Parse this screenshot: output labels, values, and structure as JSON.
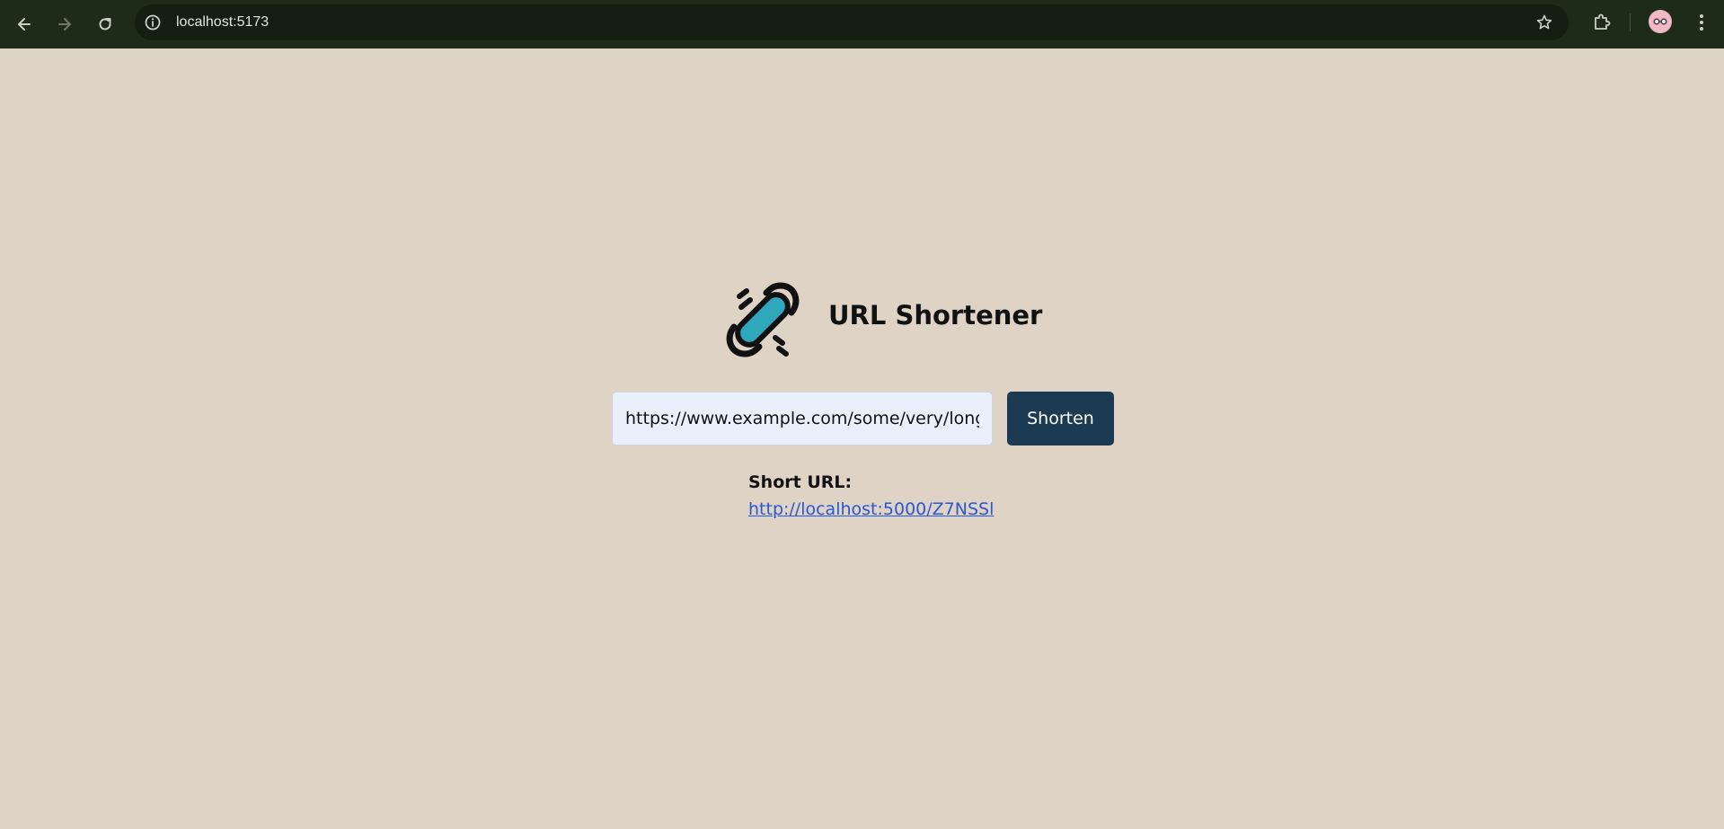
{
  "browser": {
    "url": "localhost:5173",
    "icons": {
      "back": "back-arrow-icon",
      "forward": "forward-arrow-icon",
      "reload": "reload-icon",
      "site_info": "info-icon",
      "bookmark": "star-icon",
      "extensions": "puzzle-icon",
      "profile": "avatar",
      "menu": "kebab-menu-icon"
    },
    "colors": {
      "toolbar": "#1d2b19",
      "omnibox": "#132011"
    }
  },
  "app": {
    "title": "URL Shortener",
    "logo": "link-chain-icon",
    "input": {
      "value": "https://www.example.com/some/very/long/path"
    },
    "button_label": "Shorten",
    "result": {
      "label": "Short URL:",
      "link": "http://localhost:5000/Z7NSSl"
    },
    "colors": {
      "background": "#dfd3c5",
      "button": "#1c3a52",
      "link": "#2a57d6",
      "logo_accent": "#2fa7bd"
    }
  }
}
